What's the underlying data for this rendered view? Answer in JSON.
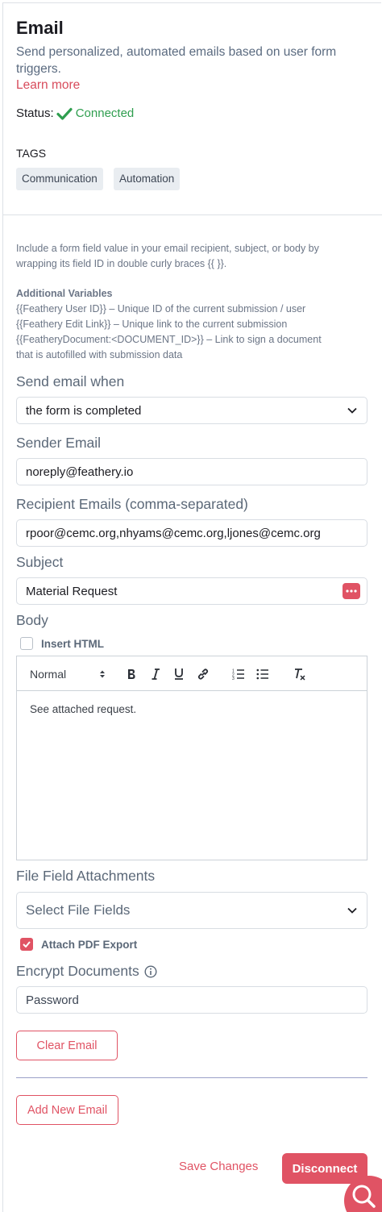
{
  "header": {
    "title": "Email",
    "description": "Send personalized, automated emails based on user form triggers.",
    "learn_more": "Learn more",
    "status_label": "Status:",
    "status_value": "Connected"
  },
  "tags": {
    "heading": "TAGS",
    "items": [
      "Communication",
      "Automation"
    ]
  },
  "info": {
    "intro_line1": "Include a form field value in your email recipient, subject, or body by",
    "intro_line2": "wrapping its field ID in double curly braces {{ }}.",
    "vars_heading": "Additional Variables",
    "var1": "{{Feathery User ID}} – Unique ID of the current submission / user",
    "var2": "{{Feathery Edit Link}} – Unique link to the current submission",
    "var3a": "{{FeatheryDocument:<DOCUMENT_ID>}} – Link to sign a document",
    "var3b": "that is autofilled with submission data"
  },
  "form": {
    "send_when_label": "Send email when",
    "send_when_value": "the form is completed",
    "sender_label": "Sender Email",
    "sender_value": "noreply@feathery.io",
    "recipients_label": "Recipient Emails (comma-separated)",
    "recipients_value": "rpoor@cemc.org,nhyams@cemc.org,ljones@cemc.org",
    "subject_label": "Subject",
    "subject_value": "Material Request",
    "body_label": "Body",
    "insert_html_label": "Insert HTML",
    "insert_html_checked": false,
    "editor": {
      "heading_select": "Normal",
      "body_text": "See attached request."
    },
    "attachments_label": "File Field Attachments",
    "attachments_placeholder": "Select File Fields",
    "attach_pdf_label": "Attach PDF Export",
    "attach_pdf_checked": true,
    "encrypt_label": "Encrypt Documents",
    "password_placeholder": "Password",
    "clear_email": "Clear Email",
    "add_new_email": "Add New Email"
  },
  "footer": {
    "save_changes": "Save Changes",
    "disconnect": "Disconnect"
  },
  "colors": {
    "accent": "#e05364",
    "connected": "#2f9e4f",
    "muted_text": "#5b6878"
  }
}
